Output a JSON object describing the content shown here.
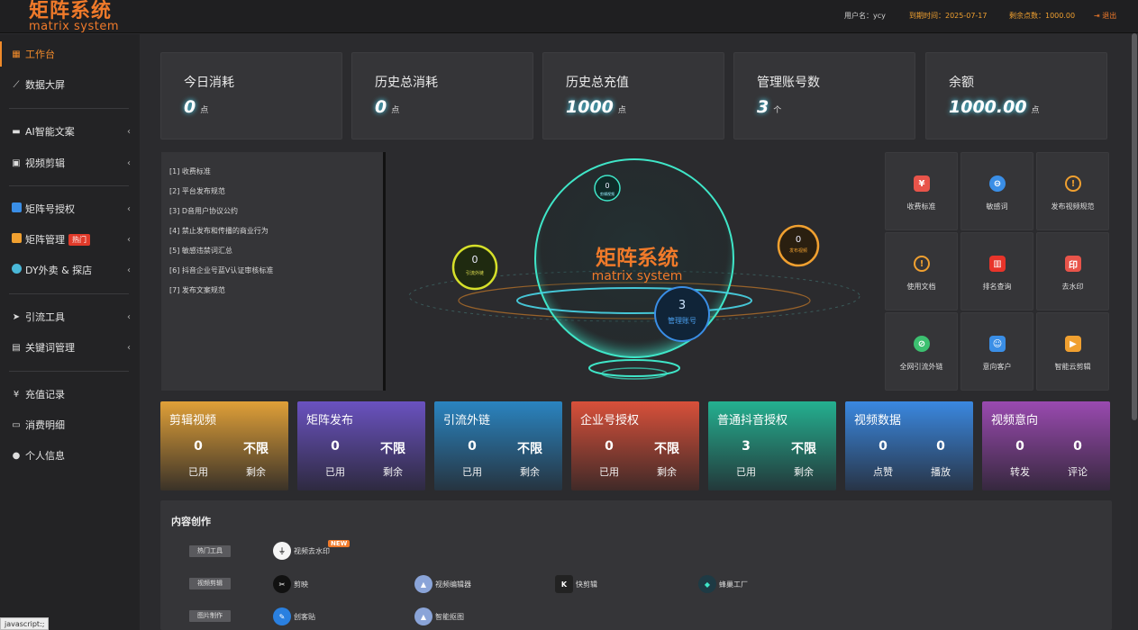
{
  "header": {
    "logo_cn": "矩阵系统",
    "logo_en": "matrix system",
    "user": "用户名：ycy",
    "expire": "到期时间：2025-07-17",
    "points": "剩余点数：1000.00",
    "logout": "退出"
  },
  "sidebar": {
    "items": [
      {
        "label": "工作台",
        "icon": "windows-icon"
      },
      {
        "label": "数据大屏",
        "icon": "chart-line-icon"
      },
      {
        "label": "AI智能文案",
        "icon": "folder-icon"
      },
      {
        "label": "视频剪辑",
        "icon": "film-icon"
      },
      {
        "label": "矩阵号授权",
        "icon": "account-icon"
      },
      {
        "label": "矩阵管理",
        "icon": "manage-icon",
        "badge": "热门"
      },
      {
        "label": "DY外卖 & 探店",
        "icon": "store-icon"
      },
      {
        "label": "引流工具",
        "icon": "send-icon"
      },
      {
        "label": "关键词管理",
        "icon": "file-icon"
      },
      {
        "label": "充值记录",
        "icon": "yen-icon"
      },
      {
        "label": "消费明细",
        "icon": "money-icon"
      },
      {
        "label": "个人信息",
        "icon": "user-icon"
      }
    ]
  },
  "stats": [
    {
      "label": "今日消耗",
      "value": "0",
      "unit": "点"
    },
    {
      "label": "历史总消耗",
      "value": "0",
      "unit": "点"
    },
    {
      "label": "历史总充值",
      "value": "1000",
      "unit": "点"
    },
    {
      "label": "管理账号数",
      "value": "3",
      "unit": "个"
    },
    {
      "label": "余额",
      "value": "1000.00",
      "unit": "点"
    }
  ],
  "notices": [
    "[1]  收费标准",
    "[2]  平台发布规范",
    "[3]  D音用户协议公约",
    "[4]  禁止发布和传播的商业行为",
    "[5]  敏感违禁词汇总",
    "[6]  抖音企业号蓝V认证审核标准",
    "[7]  发布文案规范"
  ],
  "visual": {
    "title_cn": "矩阵系统",
    "title_en": "matrix system",
    "orb_left": {
      "value": "0",
      "label": "引流外链"
    },
    "orb_top": {
      "value": "0",
      "label": "剪辑视频"
    },
    "orb_right": {
      "value": "0",
      "label": "发布视频"
    },
    "orb_center": {
      "value": "3",
      "label": "管理账号"
    }
  },
  "tiles": [
    {
      "label": "收费标准",
      "icon": "pricing-icon",
      "color": "#e8544a",
      "glyph": "¥"
    },
    {
      "label": "敏感词",
      "icon": "sensitive-word-icon",
      "color": "#3a8ee6",
      "glyph": "⊖"
    },
    {
      "label": "发布视频规范",
      "icon": "warning-icon",
      "color": "#f0a030",
      "glyph": "!"
    },
    {
      "label": "使用文档",
      "icon": "warning-icon",
      "color": "#f0a030",
      "glyph": "!"
    },
    {
      "label": "排名查询",
      "icon": "rank-icon",
      "color": "#e8342a",
      "glyph": "▥"
    },
    {
      "label": "去水印",
      "icon": "seal-icon",
      "color": "#e8544a",
      "glyph": "印"
    },
    {
      "label": "全网引流外链",
      "icon": "link-icon",
      "color": "#3cc070",
      "glyph": "⊘"
    },
    {
      "label": "意向客户",
      "icon": "customer-icon",
      "color": "#3a8ee6",
      "glyph": "☺"
    },
    {
      "label": "智能云剪辑",
      "icon": "video-edit-icon",
      "color": "#f0a030",
      "glyph": "▶"
    }
  ],
  "quota_cards": [
    {
      "title": "剪辑视频",
      "v1": "0",
      "l1": "已用",
      "v2": "不限",
      "l2": "剩余",
      "color_top": "#e0a038",
      "color_bottom": "#3a3228"
    },
    {
      "title": "矩阵发布",
      "v1": "0",
      "l1": "已用",
      "v2": "不限",
      "l2": "剩余",
      "color_top": "#6a52c0",
      "color_bottom": "#2e2a40"
    },
    {
      "title": "引流外链",
      "v1": "0",
      "l1": "已用",
      "v2": "不限",
      "l2": "剩余",
      "color_top": "#2a84c0",
      "color_bottom": "#263440"
    },
    {
      "title": "企业号授权",
      "v1": "0",
      "l1": "已用",
      "v2": "不限",
      "l2": "剩余",
      "color_top": "#d8503a",
      "color_bottom": "#402a28"
    },
    {
      "title": "普通抖音授权",
      "v1": "3",
      "l1": "已用",
      "v2": "不限",
      "l2": "剩余",
      "color_top": "#24b090",
      "color_bottom": "#23383a"
    },
    {
      "title": "视频数据",
      "v1": "0",
      "l1": "点赞",
      "v2": "0",
      "l2": "播放",
      "color_top": "#3a88e0",
      "color_bottom": "#283446"
    },
    {
      "title": "视频意向",
      "v1": "0",
      "l1": "转发",
      "v2": "0",
      "l2": "评论",
      "color_top": "#9a4ab0",
      "color_bottom": "#36283e"
    }
  ],
  "content": {
    "title": "内容创作",
    "rows": [
      {
        "tag": "热门工具",
        "tools": [
          {
            "label": "视频去水印",
            "icon": "dewatermark-icon",
            "color": "#f5f5f5",
            "glyph": "⏚",
            "badge": "NEW"
          }
        ]
      },
      {
        "tag": "视频剪辑",
        "tools": [
          {
            "label": "剪映",
            "icon": "capcut-icon",
            "color": "#111111",
            "glyph": "✂"
          },
          {
            "label": "视频编辑器",
            "icon": "video-editor-icon",
            "color": "#8aa4d8",
            "glyph": "▲"
          },
          {
            "label": "快剪辑",
            "icon": "kuaijianji-icon",
            "color": "#222222",
            "glyph": "K"
          },
          {
            "label": "蜂巢工厂",
            "icon": "beehive-icon",
            "color": "#1e3a44",
            "glyph": "◆"
          }
        ]
      },
      {
        "tag": "图片制作",
        "tools": [
          {
            "label": "创客贴",
            "icon": "chuangketie-icon",
            "color": "#2a80e0",
            "glyph": "✎"
          },
          {
            "label": "智能抠图",
            "icon": "matting-icon",
            "color": "#8aa4d8",
            "glyph": "▲"
          }
        ]
      }
    ]
  },
  "status_text": "javascript:;"
}
